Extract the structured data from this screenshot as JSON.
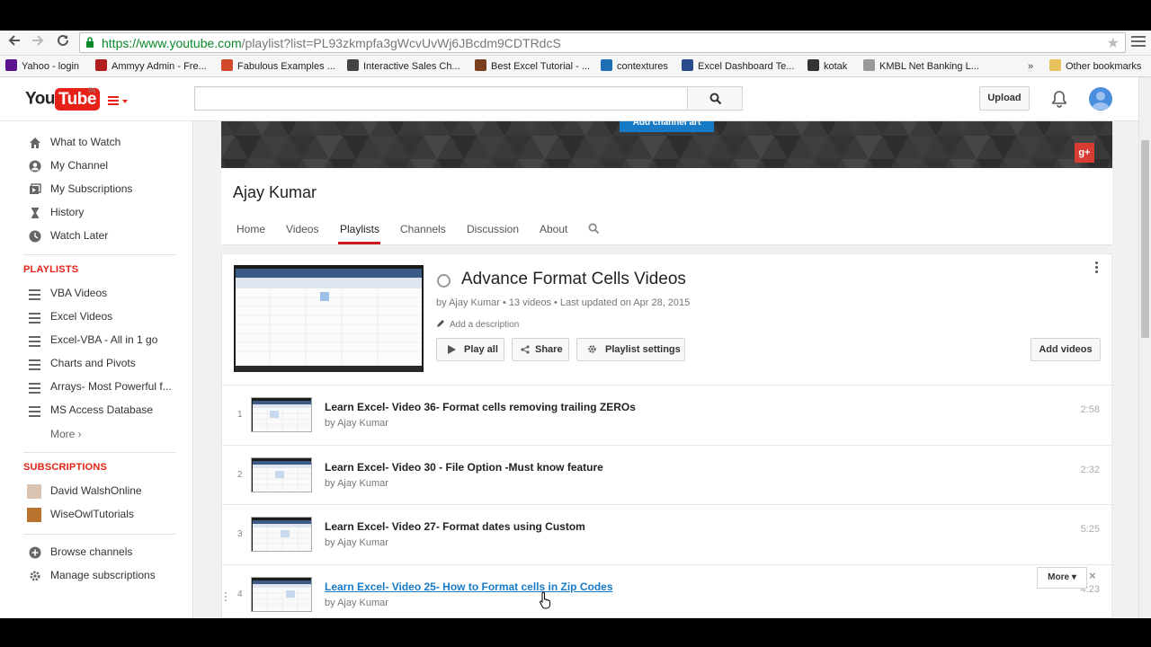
{
  "browser": {
    "url_domain": "https://www.youtube.com",
    "url_path": "/playlist?list=PL93zkmpfa3gWcvUvWj6JBcdm9CDTRdcS",
    "bookmarks": [
      {
        "label": "Yahoo - login",
        "icon": "yahoo-icon",
        "color": "#5c138f"
      },
      {
        "label": "Ammyy Admin - Fre...",
        "icon": "ammyy-icon",
        "color": "#b21d1d"
      },
      {
        "label": "Fabulous Examples ...",
        "icon": "star-burst-icon",
        "color": "#d24a2b"
      },
      {
        "label": "Interactive Sales Ch...",
        "icon": "monitor-icon",
        "color": "#444444"
      },
      {
        "label": "Best Excel Tutorial - ...",
        "icon": "tutorial-icon",
        "color": "#7b3f1d"
      },
      {
        "label": "contextures",
        "icon": "contextures-icon",
        "color": "#1e6fb5"
      },
      {
        "label": "Excel Dashboard Te...",
        "icon": "grid-icon",
        "color": "#2b4a8b"
      },
      {
        "label": "kotak",
        "icon": "kotak-icon",
        "color": "#333333"
      },
      {
        "label": "KMBL Net Banking L...",
        "icon": "page-icon",
        "color": "#999999"
      }
    ],
    "bookmarks_overflow": "»",
    "other_bookmarks": "Other bookmarks"
  },
  "header": {
    "logo_you": "You",
    "logo_tube": "Tube",
    "country": "IN",
    "upload_label": "Upload"
  },
  "sidebar": {
    "nav": [
      {
        "label": "What to Watch",
        "icon": "home-icon"
      },
      {
        "label": "My Channel",
        "icon": "person-icon"
      },
      {
        "label": "My Subscriptions",
        "icon": "subscriptions-icon"
      },
      {
        "label": "History",
        "icon": "hourglass-icon"
      },
      {
        "label": "Watch Later",
        "icon": "clock-icon"
      }
    ],
    "playlists_heading": "PLAYLISTS",
    "playlists": [
      "VBA Videos",
      "Excel Videos",
      "Excel-VBA - All in 1 go",
      "Charts and Pivots",
      "Arrays- Most Powerful f...",
      "MS Access Database"
    ],
    "more_label": "More ›",
    "subscriptions_heading": "SUBSCRIPTIONS",
    "subscriptions": [
      "David WalshOnline",
      "WiseOwlTutorials"
    ],
    "footer": [
      {
        "label": "Browse channels",
        "icon": "plus-circle-icon"
      },
      {
        "label": "Manage subscriptions",
        "icon": "gear-icon"
      }
    ]
  },
  "channel": {
    "banner_button": "Add channel art",
    "name": "Ajay Kumar",
    "tabs": [
      "Home",
      "Videos",
      "Playlists",
      "Channels",
      "Discussion",
      "About"
    ],
    "active_tab": "Playlists"
  },
  "playlist": {
    "title": "Advance Format Cells Videos",
    "meta": "by Ajay Kumar • 13 videos • Last updated on Apr 28, 2015",
    "add_description": "Add a description",
    "play_all": "Play all",
    "share": "Share",
    "settings": "Playlist settings",
    "add_videos": "Add videos",
    "videos": [
      {
        "index": "1",
        "title": "Learn Excel- Video 36- Format cells removing trailing ZEROs",
        "by": "by Ajay Kumar",
        "duration": "2:58"
      },
      {
        "index": "2",
        "title": "Learn Excel- Video 30 - File Option -Must know feature",
        "by": "by Ajay Kumar",
        "duration": "2:32"
      },
      {
        "index": "3",
        "title": "Learn Excel- Video 27- Format dates using Custom",
        "by": "by Ajay Kumar",
        "duration": "5:25"
      },
      {
        "index": "4",
        "title": "Learn Excel- Video 25- How to Format cells in Zip Codes",
        "by": "by Ajay Kumar",
        "duration": "4:23"
      }
    ],
    "more_label": "More",
    "remove_label": "×"
  }
}
